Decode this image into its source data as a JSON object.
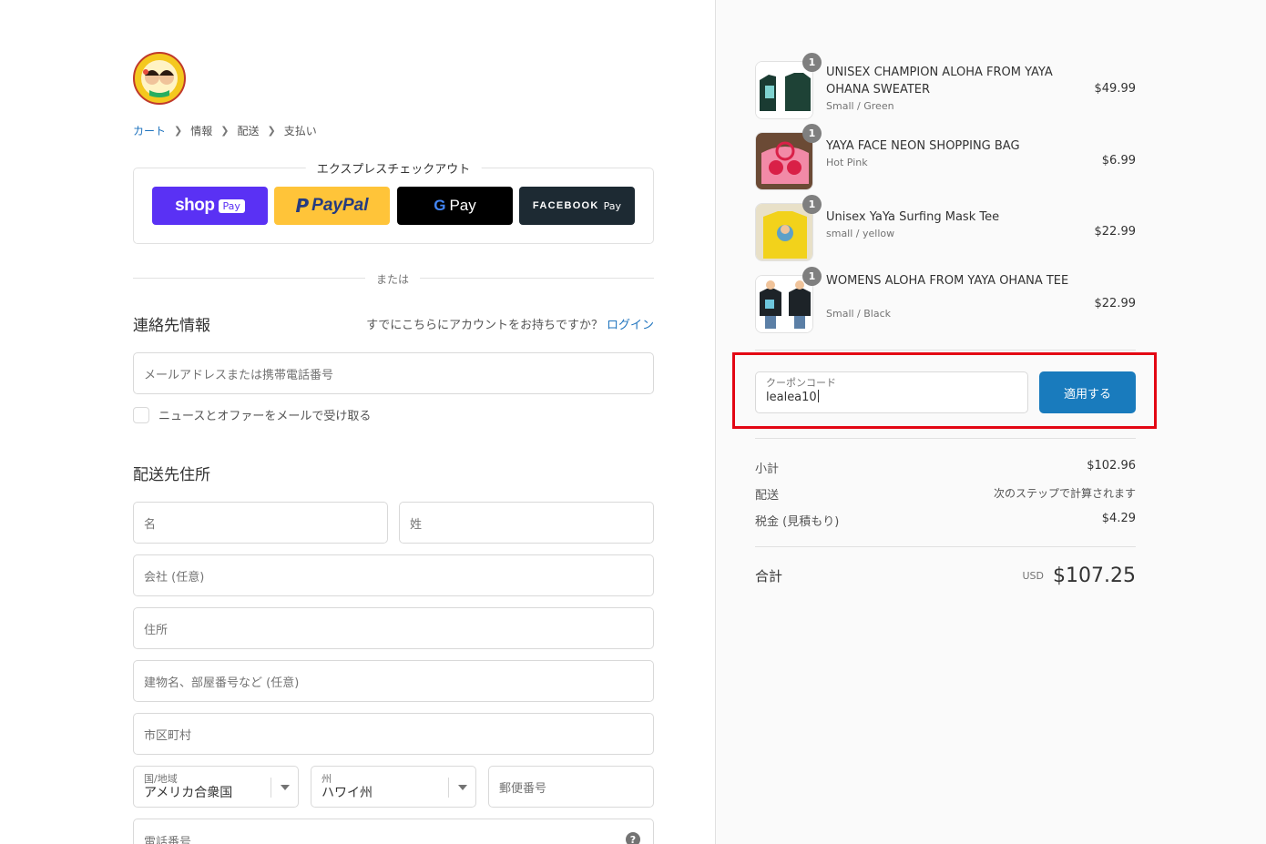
{
  "colors": {
    "link": "#1e73be",
    "apply_button": "#197bbd",
    "highlight_box": "#e30613",
    "shop_pay": "#5a31f4",
    "paypal": "#ffc439"
  },
  "breadcrumb": [
    "カート",
    "情報",
    "配送",
    "支払い"
  ],
  "express": {
    "title": "エクスプレスチェックアウト",
    "shop_pay": {
      "word": "shop",
      "pill": "Pay"
    },
    "paypal": {
      "p": "P",
      "word": "PayPal"
    },
    "gpay": {
      "g": "G",
      "word": "Pay"
    },
    "facebook_pay": {
      "word": "FACEBOOK",
      "pay": "Pay"
    }
  },
  "or_text": "または",
  "contact": {
    "title": "連絡先情報",
    "account_prompt": "すでにこちらにアカウントをお持ちですか？",
    "login_link": "ログイン",
    "email_placeholder": "メールアドレスまたは携帯電話番号",
    "newsletter_label": "ニュースとオファーをメールで受け取る"
  },
  "shipping": {
    "title": "配送先住所",
    "first_name_placeholder": "名",
    "last_name_placeholder": "姓",
    "company_placeholder": "会社 (任意)",
    "address_placeholder": "住所",
    "apartment_placeholder": "建物名、部屋番号など (任意)",
    "city_placeholder": "市区町村",
    "country_label": "国/地域",
    "country_value": "アメリカ合衆国",
    "state_label": "州",
    "state_value": "ハワイ州",
    "zip_placeholder": "郵便番号",
    "phone_placeholder": "電話番号"
  },
  "cart_items": [
    {
      "name": "UNISEX CHAMPION ALOHA FROM YAYA OHANA SWEATER",
      "variant": "Small / Green",
      "price": "$49.99",
      "qty": "1"
    },
    {
      "name": "YAYA FACE NEON SHOPPING BAG",
      "variant": "Hot Pink",
      "price": "$6.99",
      "qty": "1"
    },
    {
      "name": "Unisex YaYa Surfing Mask Tee",
      "variant": "small / yellow",
      "price": "$22.99",
      "qty": "1"
    },
    {
      "name": "WOMENS ALOHA FROM YAYA OHANA TEE",
      "variant": "Small / Black",
      "price": "$22.99",
      "qty": "1"
    }
  ],
  "coupon": {
    "label": "クーポンコード",
    "value": "lealea10",
    "apply_label": "適用する"
  },
  "summary": {
    "subtotal_label": "小計",
    "subtotal_value": "$102.96",
    "shipping_label": "配送",
    "shipping_value": "次のステップで計算されます",
    "tax_label": "税金 (見積もり)",
    "tax_value": "$4.29",
    "total_label": "合計",
    "total_currency": "USD",
    "total_value": "$107.25"
  }
}
